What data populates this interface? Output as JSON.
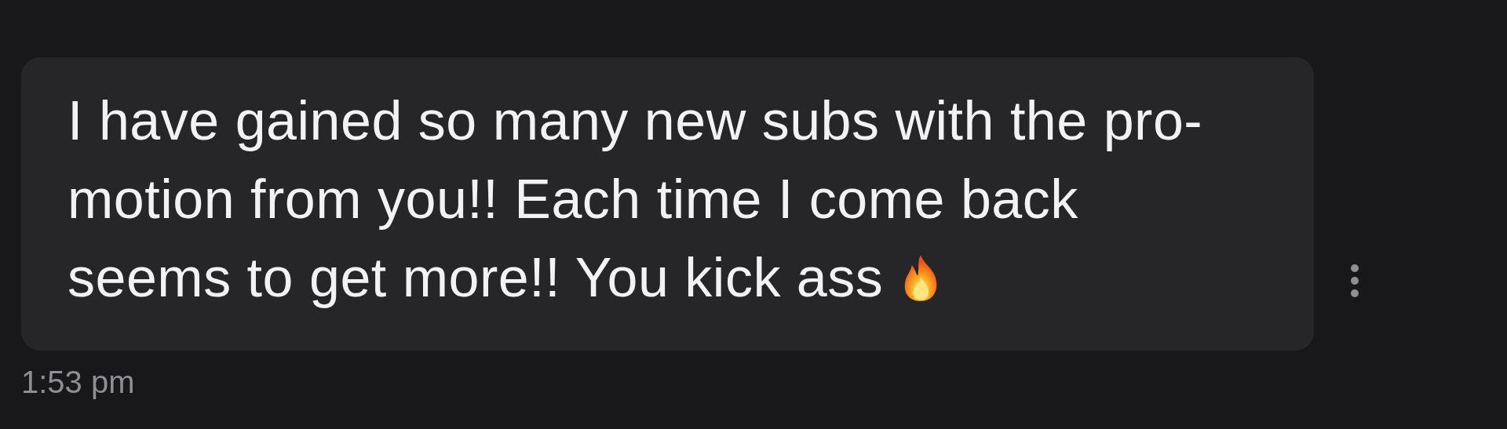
{
  "message": {
    "lines": [
      "I have gained so many new subs with the pro-",
      "motion from you!! Each time I come back",
      "seems to get more!! You kick ass"
    ],
    "timestamp": "1:53 pm"
  }
}
